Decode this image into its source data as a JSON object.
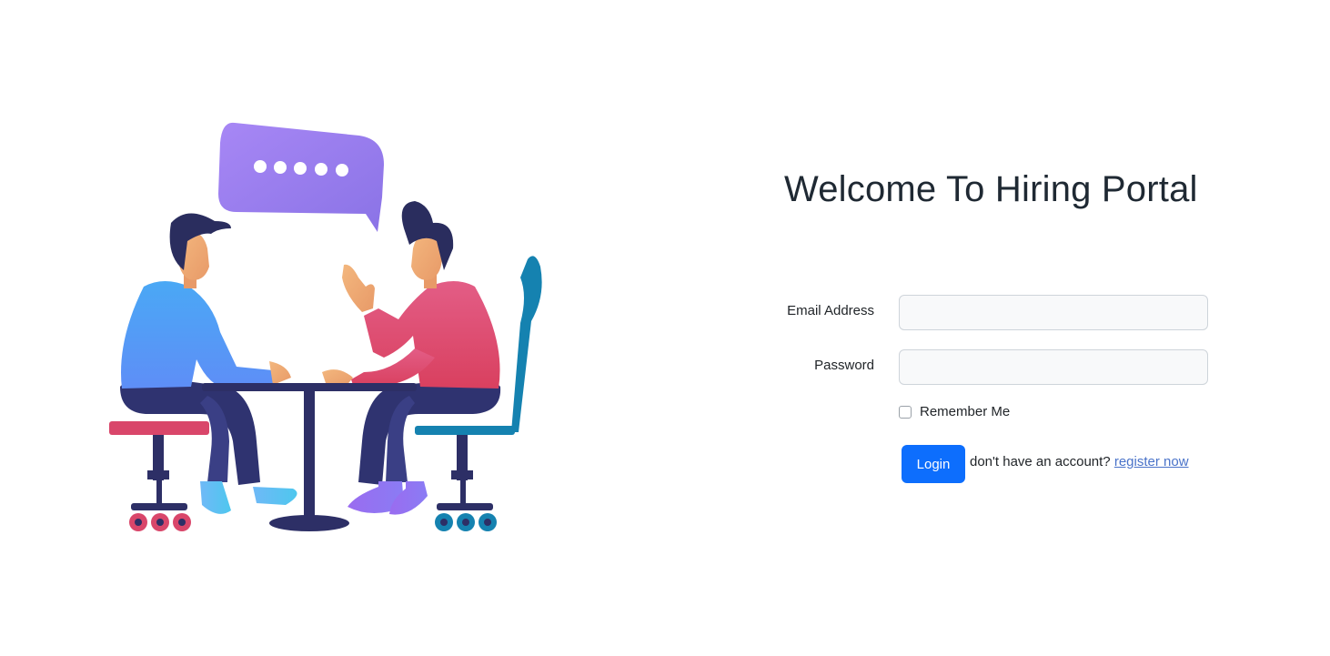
{
  "page": {
    "title": "Welcome To Hiring Portal"
  },
  "form": {
    "email_label": "Email Address",
    "email_value": "",
    "password_label": "Password",
    "password_value": "",
    "remember_label": "Remember Me",
    "remember_checked": false,
    "login_label": "Login",
    "register_prompt": "don't have an account?",
    "register_link": "register now"
  },
  "illustration": {
    "icon": "interview-illustration",
    "colors": {
      "bubble": "#9a7cf0",
      "left_shirt": "#4aa8f5",
      "right_shirt": "#e6517a",
      "pants": "#2f3370",
      "left_seat": "#d9466a",
      "right_chair": "#1582b0",
      "table": "#2d2f66"
    }
  },
  "colors": {
    "primary": "#0d6efd",
    "link": "#4a73c9",
    "input_bg": "#f8f9fa"
  }
}
